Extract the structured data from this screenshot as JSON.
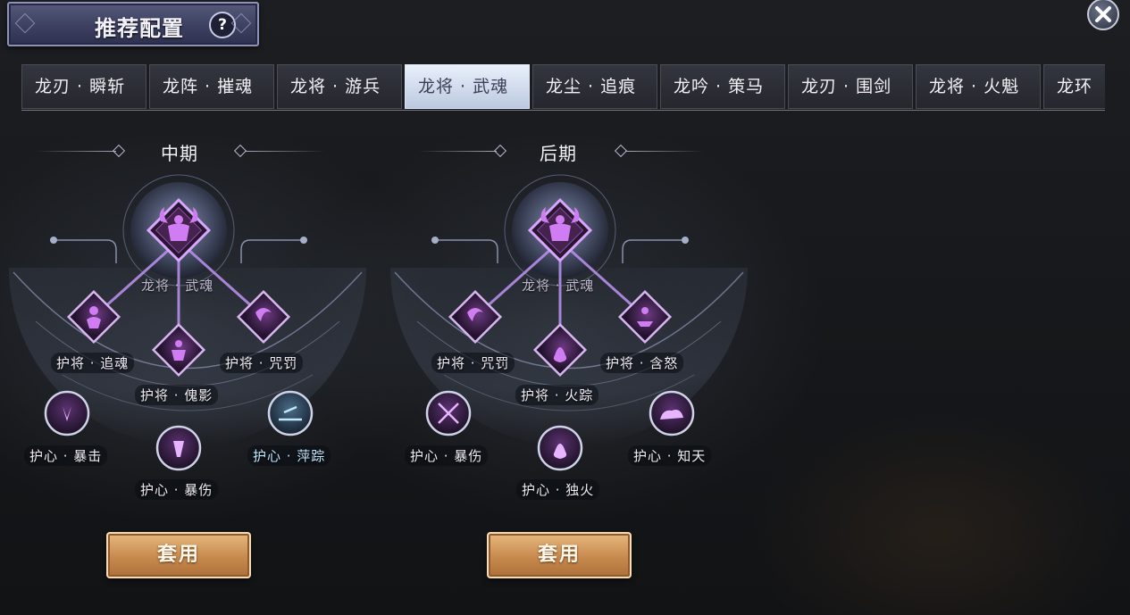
{
  "header": {
    "title": "推荐配置",
    "help_label": "?"
  },
  "tabs": [
    {
      "label": "龙刃 · 瞬斩",
      "active": false
    },
    {
      "label": "龙阵 · 摧魂",
      "active": false
    },
    {
      "label": "龙将 · 游兵",
      "active": false
    },
    {
      "label": "龙将 · 武魂",
      "active": true
    },
    {
      "label": "龙尘 · 追痕",
      "active": false
    },
    {
      "label": "龙吟 · 策马",
      "active": false
    },
    {
      "label": "龙刃 · 围剑",
      "active": false
    },
    {
      "label": "龙将 · 火魁",
      "active": false
    },
    {
      "label": "龙环",
      "active": false
    }
  ],
  "panels": [
    {
      "phase": "中期",
      "core": "龙将 · 武魂",
      "generals": [
        "护将 · 追魂",
        "护将 · 傀影",
        "护将 · 咒罚"
      ],
      "hearts": [
        "护心 · 暴击",
        "护心 · 暴伤",
        "护心 · 萍踪"
      ],
      "apply_label": "套用"
    },
    {
      "phase": "后期",
      "core": "龙将 · 武魂",
      "generals": [
        "护将 · 咒罚",
        "护将 · 火踪",
        "护将 · 含怒"
      ],
      "hearts": [
        "护心 · 暴伤",
        "护心 · 独火",
        "护心 · 知天"
      ],
      "apply_label": "套用"
    }
  ],
  "colors": {
    "accent_purple": "#c56ee8",
    "tab_active": "#dfe6f4",
    "button_gold": "#c78a4e"
  }
}
